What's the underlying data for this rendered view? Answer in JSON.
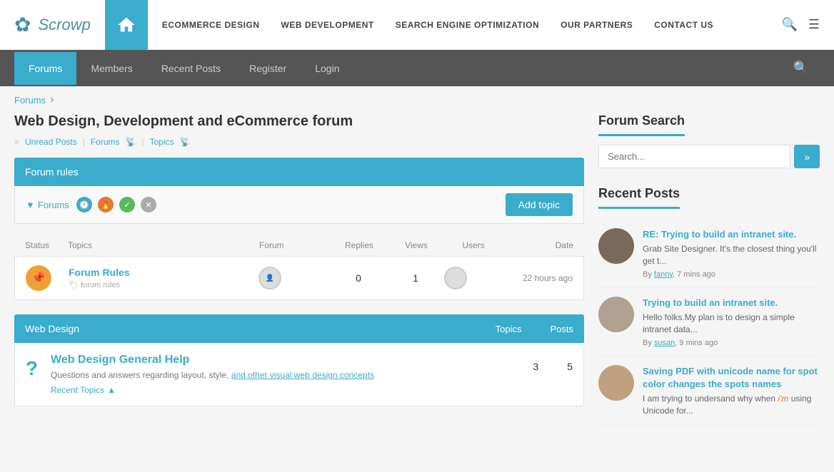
{
  "brand": {
    "name": "Scrowp"
  },
  "topnav": {
    "menu": [
      {
        "label": "Ecommerce Design",
        "href": "#"
      },
      {
        "label": "Web Development",
        "href": "#"
      },
      {
        "label": "Search Engine Optimization",
        "href": "#"
      },
      {
        "label": "Our Partners",
        "href": "#"
      },
      {
        "label": "Contact Us",
        "href": "#"
      }
    ]
  },
  "subnav": {
    "tabs": [
      {
        "label": "Forums",
        "active": true
      },
      {
        "label": "Members",
        "active": false
      },
      {
        "label": "Recent Posts",
        "active": false
      },
      {
        "label": "Register",
        "active": false
      },
      {
        "label": "Login",
        "active": false
      }
    ]
  },
  "breadcrumb": {
    "items": [
      {
        "label": "Forums",
        "href": "#"
      }
    ]
  },
  "forum": {
    "title": "Web Design, Development and eCommerce forum",
    "meta": {
      "unread": "Unread Posts",
      "sep1": "|",
      "forums": "Forums",
      "sep2": "|",
      "topics": "Topics"
    },
    "rules_label": "Forum rules",
    "filter_label": "Forums",
    "add_topic": "Add topic",
    "table_headers": {
      "status": "Status",
      "topics": "Topics",
      "forum": "Forum",
      "replies": "Replies",
      "views": "Views",
      "users": "Users",
      "date": "Date"
    },
    "rows": [
      {
        "title": "Forum Rules",
        "tag": "forum rules",
        "replies": "0",
        "views": "1",
        "date": "22 hours ago"
      }
    ],
    "sections": [
      {
        "title": "Web Design",
        "topics_label": "Topics",
        "posts_label": "Posts",
        "subforums": [
          {
            "title": "Web Design General Help",
            "description": "Questions and answers regarding layout, style, and other visual web design concepts",
            "recent_topics": "Recent Topics",
            "topics": "3",
            "posts": "5"
          }
        ]
      }
    ]
  },
  "sidebar": {
    "search": {
      "title": "Forum Search",
      "placeholder": "Search...",
      "button": "»"
    },
    "recent_posts": {
      "title": "Recent Posts",
      "items": [
        {
          "title": "RE: Trying to build an intranet site.",
          "excerpt": "Grab Site Designer. It's the closest thing you'll get t...",
          "author": "fanny",
          "time": "7 mins ago",
          "avatar_style": "brown"
        },
        {
          "title": "Trying to build an intranet site.",
          "excerpt": "Hello folks.My plan is to design a simple intranet data...",
          "author": "susan",
          "time": "9 mins ago",
          "avatar_style": "light"
        },
        {
          "title": "Saving PDF with unicode name for spot color changes the spots names",
          "excerpt": "I am trying to undersand why when i'm using Unicode for...",
          "author": "",
          "time": "",
          "avatar_style": "girl"
        }
      ]
    }
  }
}
